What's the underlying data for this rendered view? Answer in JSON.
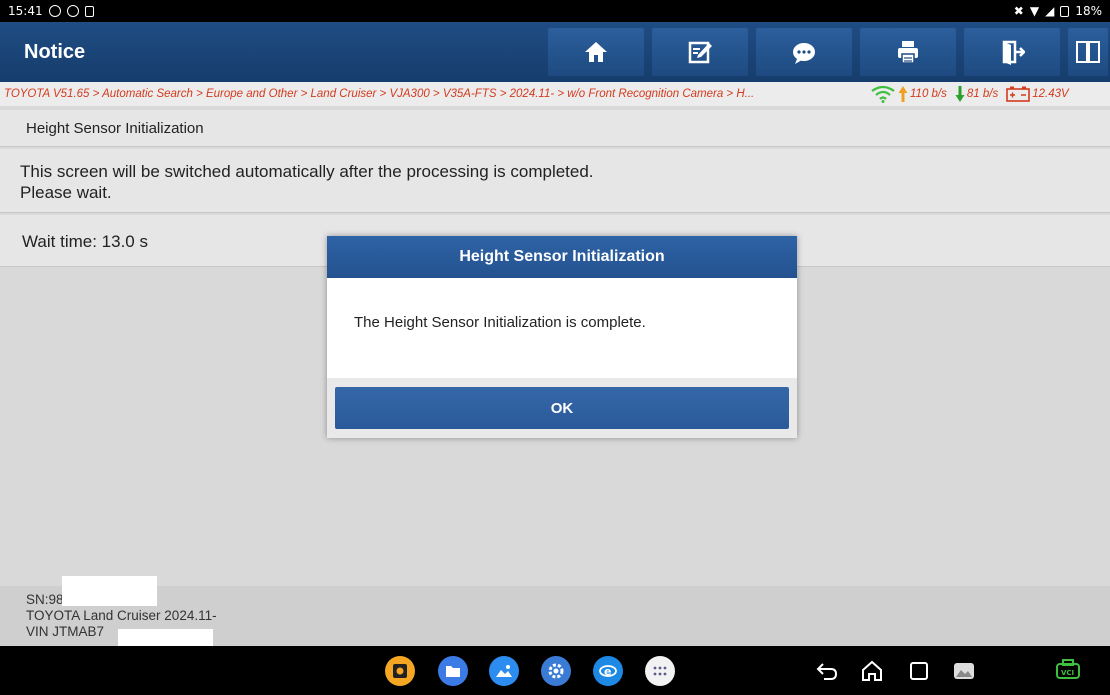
{
  "status_bar": {
    "time": "15:41",
    "battery": "18%"
  },
  "header": {
    "title": "Notice",
    "buttons": [
      "home-icon",
      "edit-icon",
      "chat-icon",
      "print-icon",
      "exit-icon",
      "split-icon"
    ]
  },
  "breadcrumb": {
    "path": "TOYOTA V51.65 > Automatic Search > Europe and Other > Land Cruiser > VJA300 > V35A-FTS > 2024.11- > w/o Front Recognition Camera > H...",
    "upload": "110 b/s",
    "download": "81 b/s",
    "voltage": "12.43V"
  },
  "page": {
    "subtitle": "Height Sensor Initialization",
    "message_line1": "This screen will be switched automatically after the processing is completed.",
    "message_line2": "Please wait.",
    "wait_time": "Wait time: 13.0 s"
  },
  "footer": {
    "sn": "SN:98",
    "vehicle": "TOYOTA Land Cruiser 2024.11-",
    "vin": "VIN JTMAB7"
  },
  "dialog": {
    "title": "Height Sensor Initialization",
    "body": "The Height Sensor Initialization is complete.",
    "ok_label": "OK"
  },
  "colors": {
    "accent": "#1f4d84",
    "breadcrumb_text": "#d33b1f",
    "vci_green": "#3fbf3f"
  }
}
